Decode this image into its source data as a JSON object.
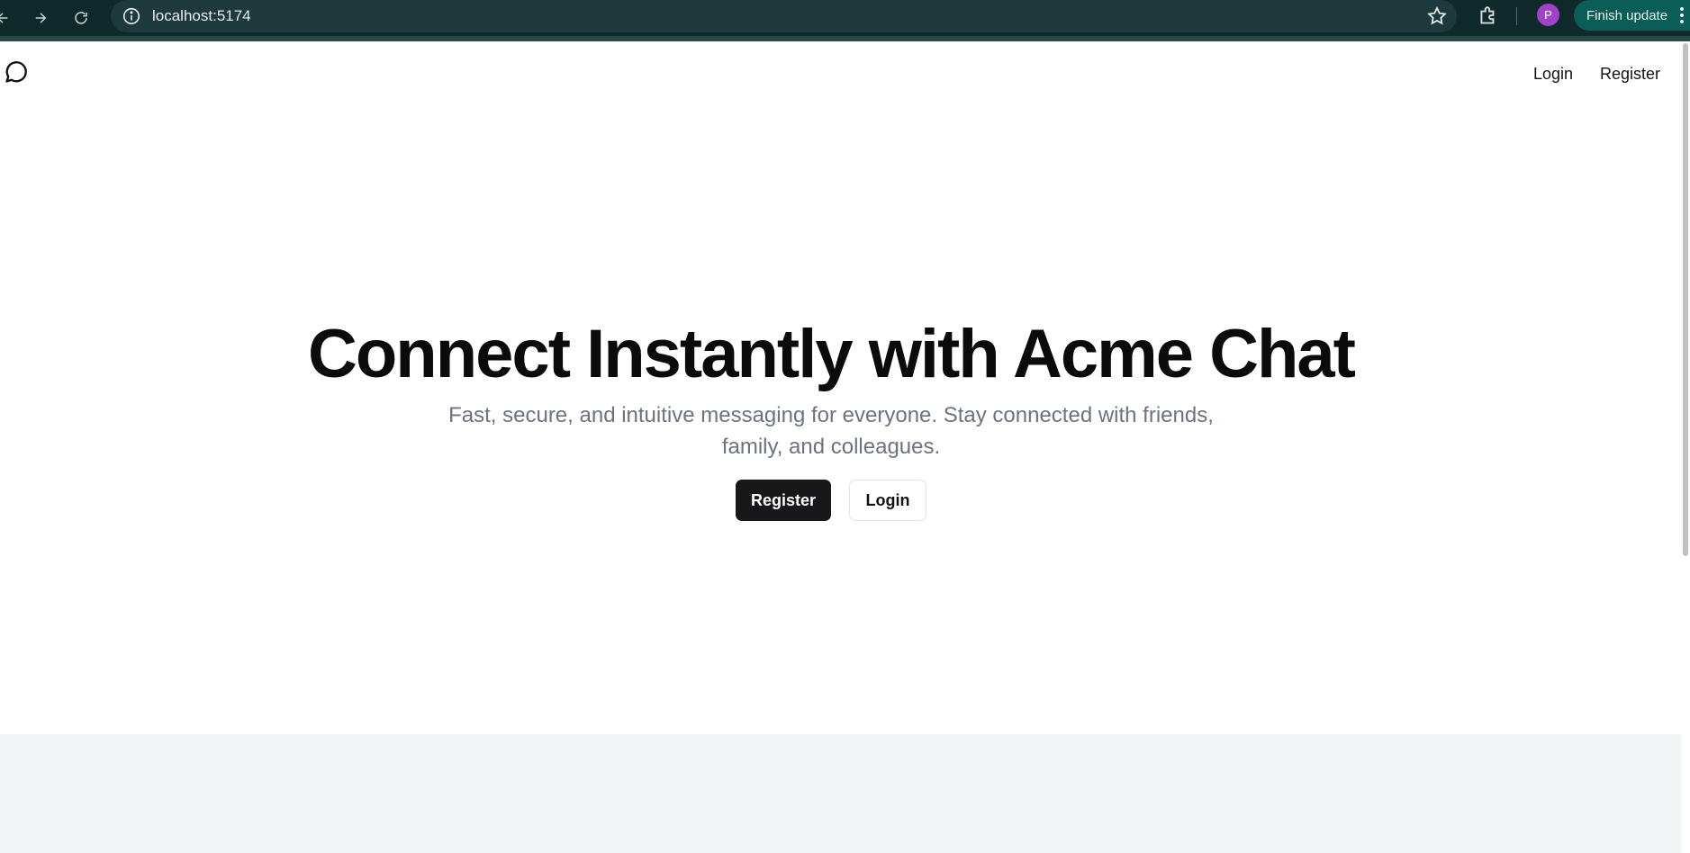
{
  "browser": {
    "url": "localhost:5174",
    "profile_initial": "P",
    "finish_update_label": "Finish update"
  },
  "header": {
    "login_label": "Login",
    "register_label": "Register"
  },
  "hero": {
    "title": "Connect Instantly with Acme Chat",
    "subtitle": "Fast, secure, and intuitive messaging for everyone. Stay connected with friends, family, and colleagues.",
    "register_label": "Register",
    "login_label": "Login"
  },
  "icons": {
    "logo": "message-circle-icon",
    "back": "arrow-left-icon",
    "forward": "arrow-right-icon",
    "reload": "reload-icon",
    "site_info": "info-icon",
    "bookmark": "star-icon",
    "extensions": "puzzle-icon",
    "menu": "more-vertical-icon"
  },
  "colors": {
    "browser_bar": "#10292b",
    "primary_button": "#18181b",
    "subtitle_text": "#6b7280",
    "avatar": "#a142c8",
    "update_button": "#0b5e58"
  }
}
